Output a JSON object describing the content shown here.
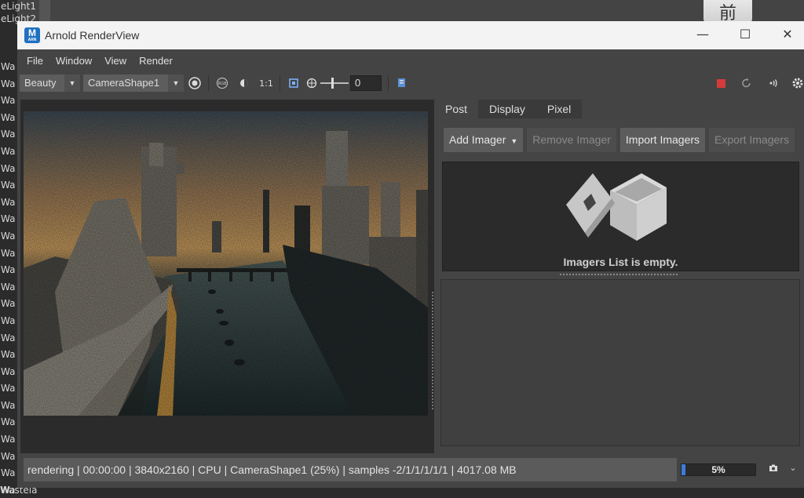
{
  "background": {
    "outliner_rows": [
      "Wa",
      "Wa",
      "Wa",
      "Wa",
      "Wa",
      "Wa",
      "Wa",
      "Wa",
      "Wa",
      "Wa",
      "Wa",
      "Wa",
      "Wa",
      "Wa",
      "Wa",
      "Wa",
      "Wa",
      "Wa",
      "Wa",
      "Wa",
      "Wa",
      "Wa",
      "Wa",
      "Wa",
      "Wa",
      "Wa",
      "Wa"
    ],
    "top_names": [
      "eLight1",
      "eLight2"
    ],
    "bottom_name": "Wastela",
    "view_cube_label": "前"
  },
  "window": {
    "title": "Arnold RenderView",
    "icon_letter": "M",
    "icon_sub": "ARN",
    "minimize_glyph": "—",
    "maximize_glyph": "☐",
    "close_glyph": "✕"
  },
  "menubar": {
    "items": [
      "File",
      "Window",
      "View",
      "Render"
    ]
  },
  "toolbar": {
    "aov_value": "Beauty",
    "camera_value": "CameraShape1",
    "exposure_value": "0",
    "ratio_label": "1:1",
    "icons": {
      "display_settings": "radio-target-icon",
      "rgb": "rgb-icon",
      "contrast": "contrast-icon",
      "crop": "crop-region-icon",
      "exposure": "exposure-icon",
      "log": "log-icon",
      "stop": "stop-icon",
      "refresh": "refresh-icon",
      "ipr": "ipr-signal-icon",
      "settings": "gear-icon"
    },
    "stop_color": "#d63a3a"
  },
  "panel": {
    "tabs": [
      "Post",
      "Display",
      "Pixel"
    ],
    "active_tab": "Post",
    "buttons": {
      "add": "Add Imager",
      "remove": "Remove Imager",
      "import": "Import Imagers",
      "export": "Export Imagers"
    },
    "empty_text": "Imagers List is empty."
  },
  "status": {
    "text": "rendering | 00:00:00 | 3840x2160 | CPU | CameraShape1 (25%) | samples -2/1/1/1/1/1 | 4017.08 MB",
    "progress": 5,
    "progress_label": "5%",
    "accent": "#3b7dd8"
  }
}
